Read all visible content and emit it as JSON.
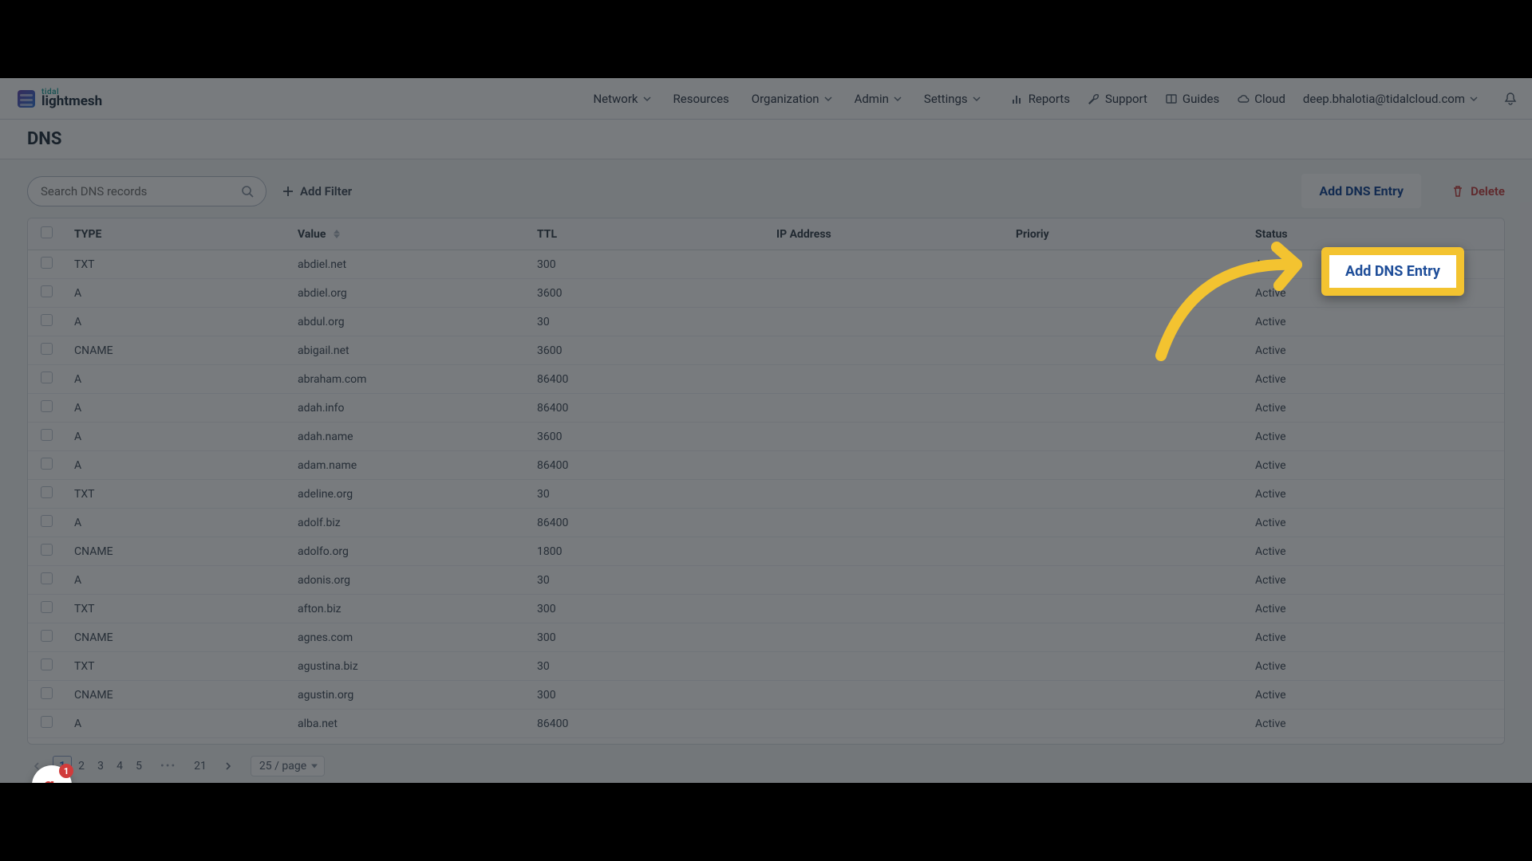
{
  "brand": {
    "sup": "tidal",
    "main": "lightmesh"
  },
  "nav": {
    "network": "Network",
    "resources": "Resources",
    "organization": "Organization",
    "admin": "Admin",
    "settings": "Settings",
    "reports": "Reports",
    "support": "Support",
    "guides": "Guides",
    "cloud": "Cloud",
    "user_email": "deep.bhalotia@tidalcloud.com"
  },
  "page": {
    "title": "DNS"
  },
  "toolbar": {
    "search_placeholder": "Search DNS records",
    "add_filter": "Add Filter",
    "add_entry": "Add DNS Entry",
    "delete": "Delete"
  },
  "columns": {
    "type": "TYPE",
    "value": "Value",
    "ttl": "TTL",
    "ip": "IP Address",
    "priority": "Prioriy",
    "status": "Status"
  },
  "rows": [
    {
      "type": "TXT",
      "value": "abdiel.net",
      "ttl": "300",
      "ip": "",
      "priority": "",
      "status": "Active"
    },
    {
      "type": "A",
      "value": "abdiel.org",
      "ttl": "3600",
      "ip": "",
      "priority": "",
      "status": "Active"
    },
    {
      "type": "A",
      "value": "abdul.org",
      "ttl": "30",
      "ip": "",
      "priority": "",
      "status": "Active"
    },
    {
      "type": "CNAME",
      "value": "abigail.net",
      "ttl": "3600",
      "ip": "",
      "priority": "",
      "status": "Active"
    },
    {
      "type": "A",
      "value": "abraham.com",
      "ttl": "86400",
      "ip": "",
      "priority": "",
      "status": "Active"
    },
    {
      "type": "A",
      "value": "adah.info",
      "ttl": "86400",
      "ip": "",
      "priority": "",
      "status": "Active"
    },
    {
      "type": "A",
      "value": "adah.name",
      "ttl": "3600",
      "ip": "",
      "priority": "",
      "status": "Active"
    },
    {
      "type": "A",
      "value": "adam.name",
      "ttl": "86400",
      "ip": "",
      "priority": "",
      "status": "Active"
    },
    {
      "type": "TXT",
      "value": "adeline.org",
      "ttl": "30",
      "ip": "",
      "priority": "",
      "status": "Active"
    },
    {
      "type": "A",
      "value": "adolf.biz",
      "ttl": "86400",
      "ip": "",
      "priority": "",
      "status": "Active"
    },
    {
      "type": "CNAME",
      "value": "adolfo.org",
      "ttl": "1800",
      "ip": "",
      "priority": "",
      "status": "Active"
    },
    {
      "type": "A",
      "value": "adonis.org",
      "ttl": "30",
      "ip": "",
      "priority": "",
      "status": "Active"
    },
    {
      "type": "TXT",
      "value": "afton.biz",
      "ttl": "300",
      "ip": "",
      "priority": "",
      "status": "Active"
    },
    {
      "type": "CNAME",
      "value": "agnes.com",
      "ttl": "300",
      "ip": "",
      "priority": "",
      "status": "Active"
    },
    {
      "type": "TXT",
      "value": "agustina.biz",
      "ttl": "30",
      "ip": "",
      "priority": "",
      "status": "Active"
    },
    {
      "type": "CNAME",
      "value": "agustin.org",
      "ttl": "300",
      "ip": "",
      "priority": "",
      "status": "Active"
    },
    {
      "type": "A",
      "value": "alba.net",
      "ttl": "86400",
      "ip": "",
      "priority": "",
      "status": "Active"
    }
  ],
  "pager": {
    "pages": [
      "1",
      "2",
      "3",
      "4",
      "5"
    ],
    "last": "21",
    "size": "25 / page"
  },
  "widget": {
    "glyph": "g.",
    "badge": "1"
  }
}
